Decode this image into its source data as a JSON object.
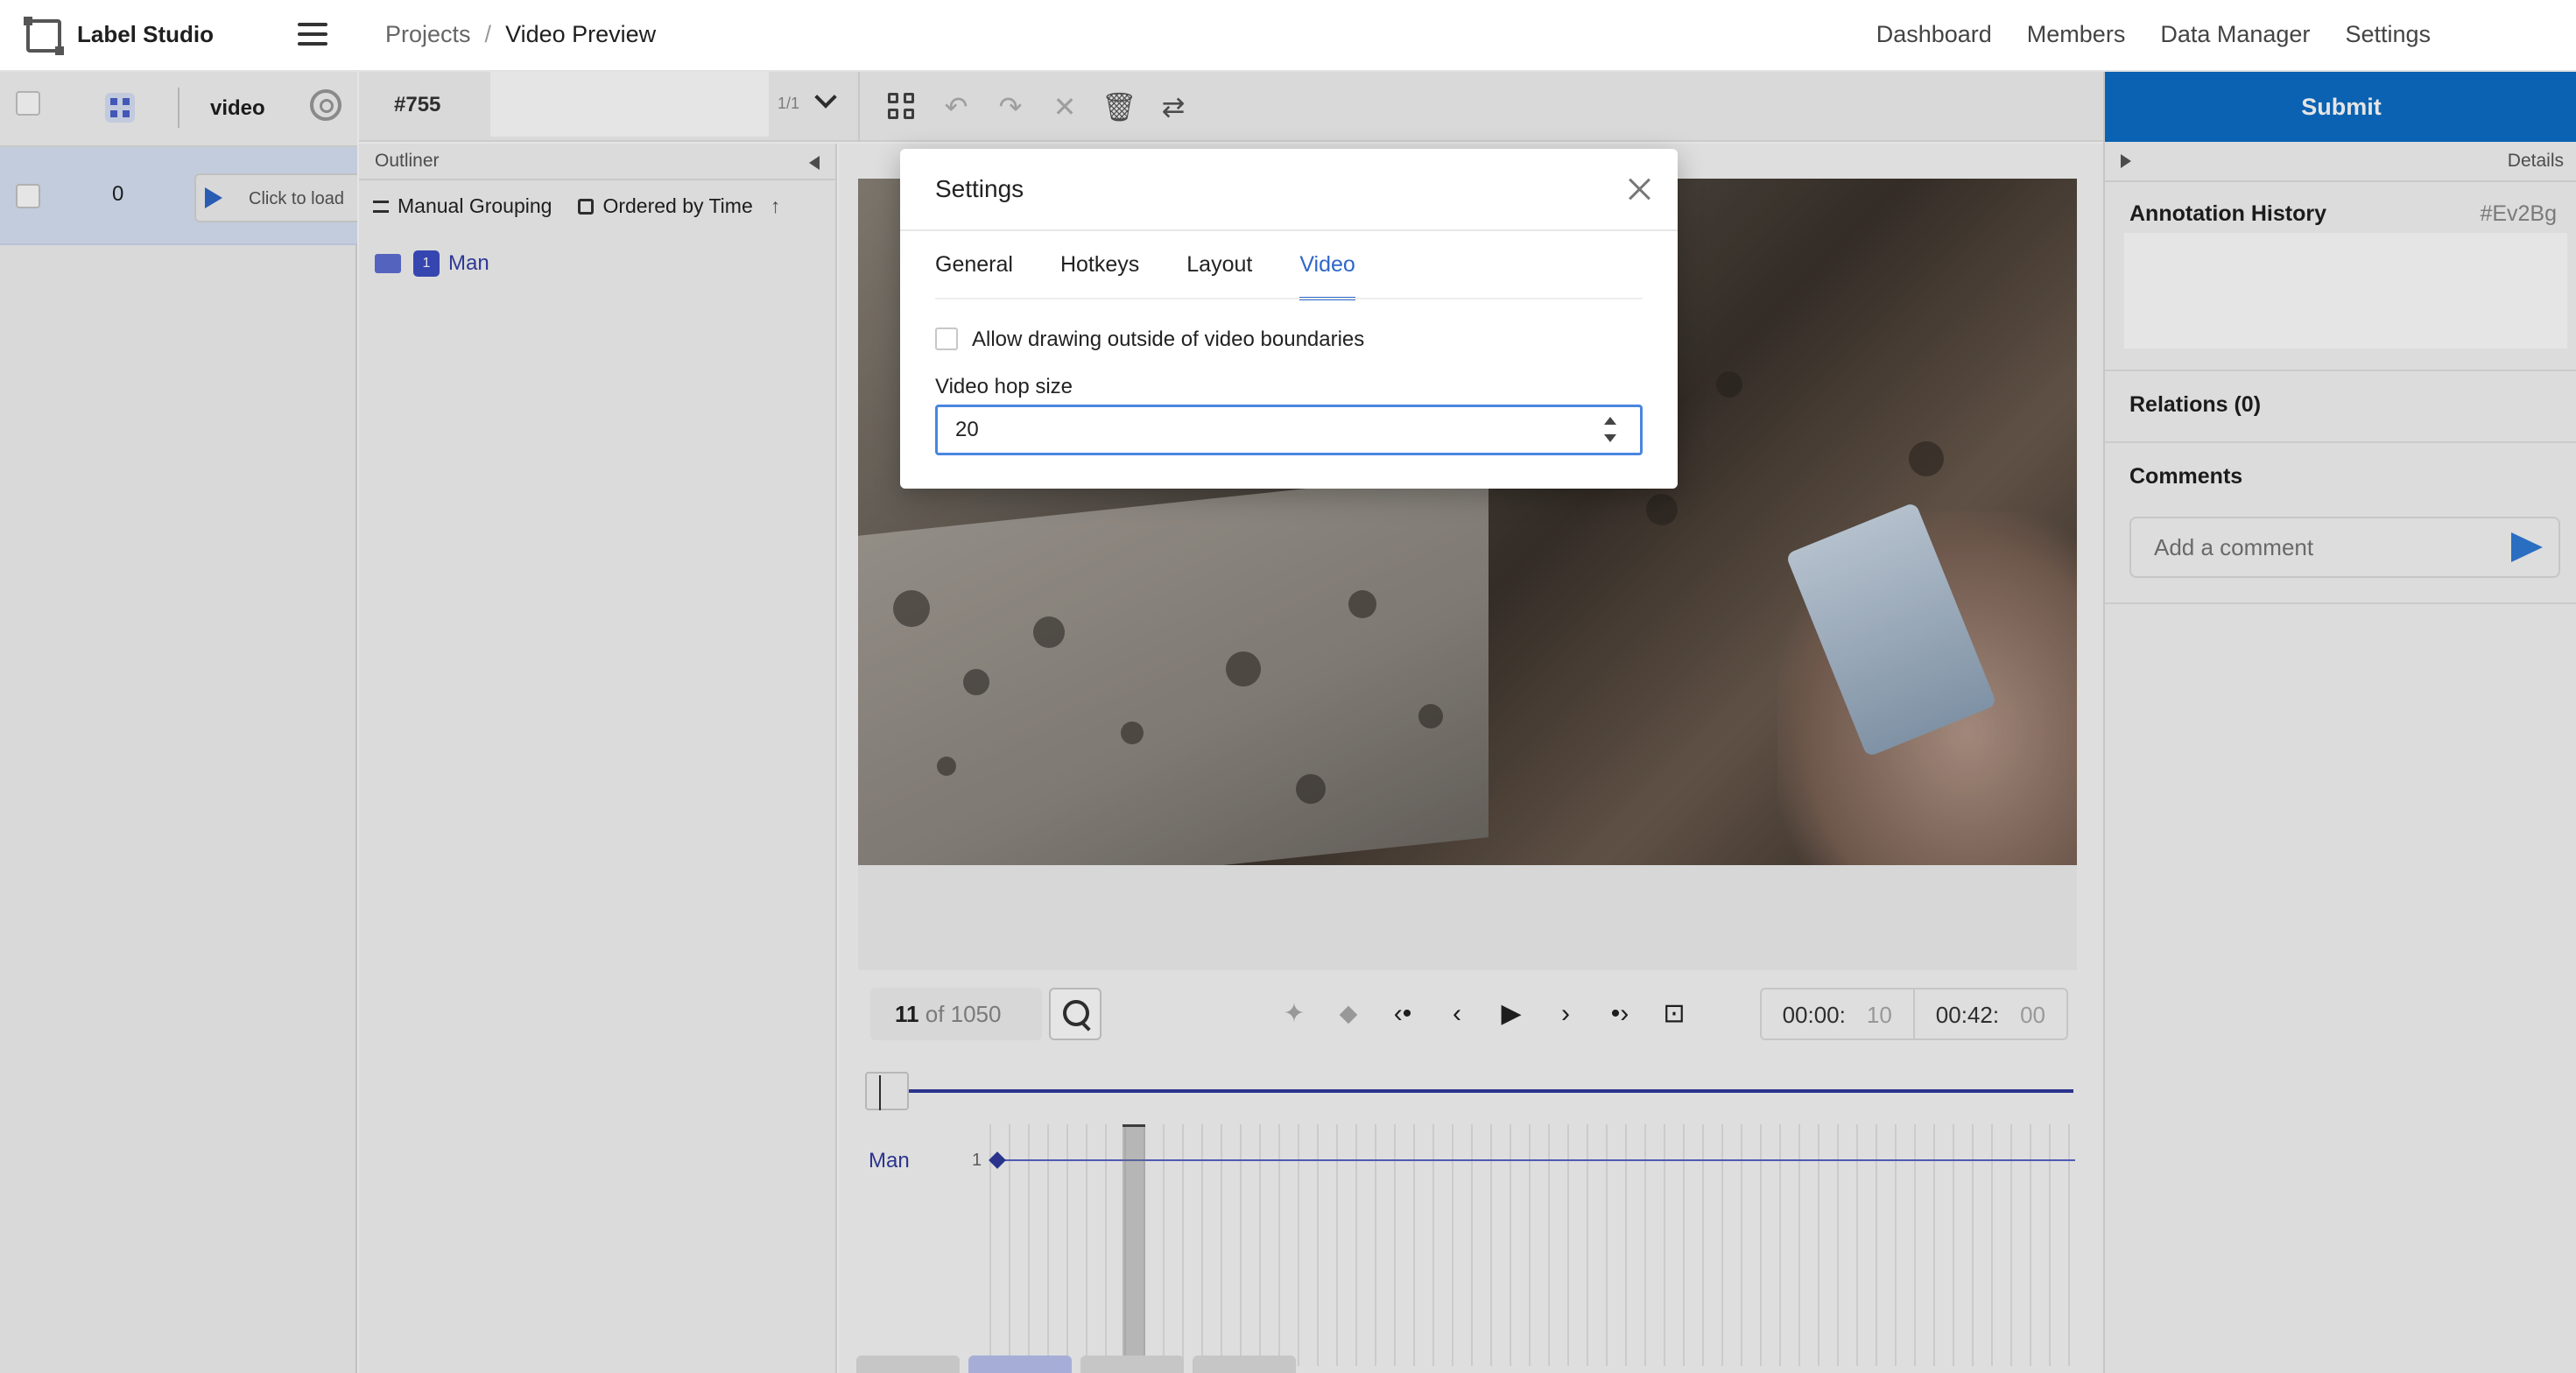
{
  "header": {
    "app_title": "Label Studio",
    "breadcrumb": {
      "projects": "Projects",
      "separator": "/",
      "current": "Video Preview"
    },
    "nav": [
      "Dashboard",
      "Members",
      "Data Manager",
      "Settings"
    ]
  },
  "tasks": {
    "column_label": "video",
    "rows": [
      {
        "id": "0",
        "load_label": "Click to load"
      }
    ]
  },
  "toolbar": {
    "task_id": "#755",
    "pager": "1/1"
  },
  "outliner": {
    "title": "Outliner",
    "grouping": "Manual Grouping",
    "ordering": "Ordered by Time",
    "regions": [
      {
        "index": "1",
        "label": "Man"
      }
    ]
  },
  "timeline": {
    "frame_current": "11",
    "frame_of": "of 1050",
    "time_current_main": "00:00:",
    "time_current_frac": "10",
    "time_total_main": "00:42:",
    "time_total_frac": "00",
    "track_label": "Man",
    "track_index": "1"
  },
  "right_panel": {
    "submit": "Submit",
    "details": "Details",
    "annotation_history": "Annotation History",
    "annotation_id": "#Ev2Bg",
    "relations": "Relations (0)",
    "comments": "Comments",
    "comment_placeholder": "Add a comment"
  },
  "modal": {
    "title": "Settings",
    "tabs": [
      "General",
      "Hotkeys",
      "Layout",
      "Video"
    ],
    "active_tab": "Video",
    "checkbox_label": "Allow drawing outside of video boundaries",
    "hop_label": "Video hop size",
    "hop_value": "20"
  },
  "colors": {
    "accent": "#0d6ec7",
    "region": "#3c4fc4",
    "tab_active": "#2f67c9"
  }
}
